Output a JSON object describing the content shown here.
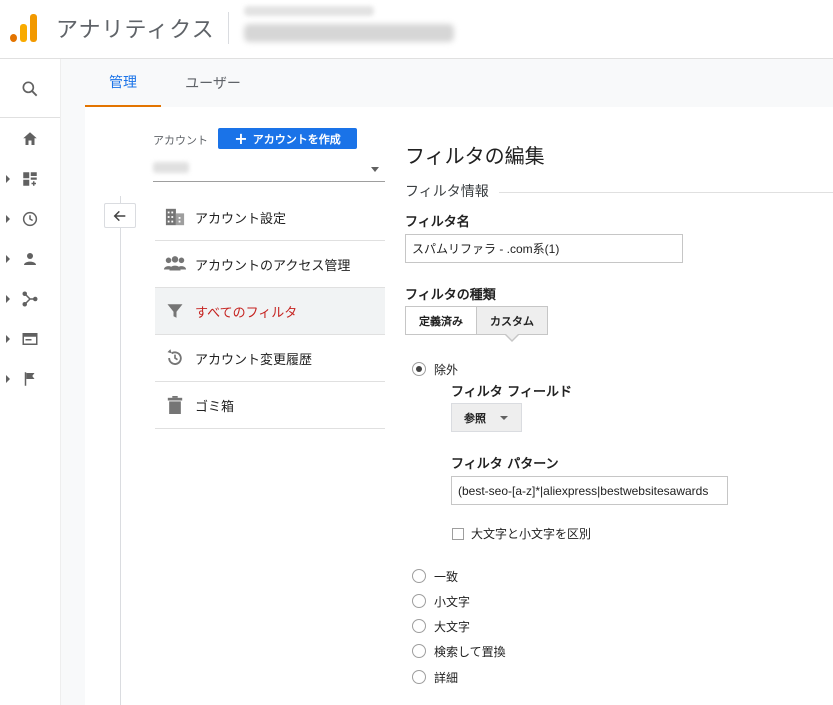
{
  "header": {
    "app_title": "アナリティクス"
  },
  "tabs": [
    {
      "label": "管理"
    },
    {
      "label": "ユーザー"
    }
  ],
  "account": {
    "label": "アカウント",
    "create_button": "アカウントを作成"
  },
  "menu": [
    {
      "label": "アカウント設定",
      "icon": "building-icon"
    },
    {
      "label": "アカウントのアクセス管理",
      "icon": "people-icon"
    },
    {
      "label": "すべてのフィルタ",
      "icon": "filter-icon",
      "selected": true
    },
    {
      "label": "アカウント変更履歴",
      "icon": "history-icon"
    },
    {
      "label": "ゴミ箱",
      "icon": "trash-icon"
    }
  ],
  "panel": {
    "title": "フィルタの編集",
    "section": "フィルタ情報",
    "filter_name_label": "フィルタ名",
    "filter_name_value": "スパムリファラ - .com系(1)",
    "filter_type_label": "フィルタの種類",
    "type_predefined": "定義済み",
    "type_custom": "カスタム",
    "exclude_label": "除外",
    "filter_field_label": "フィルタ フィールド",
    "filter_field_value": "参照",
    "filter_pattern_label": "フィルタ パターン",
    "filter_pattern_value": "(best-seo-[a-z]*|aliexpress|bestwebsitesawards",
    "case_sensitive_label": "大文字と小文字を区別",
    "options": [
      "一致",
      "小文字",
      "大文字",
      "検索して置換",
      "詳細"
    ]
  },
  "colors": {
    "accent_blue": "#1a73e8",
    "tab_underline": "#e37400",
    "selected_text": "#c5221f"
  }
}
